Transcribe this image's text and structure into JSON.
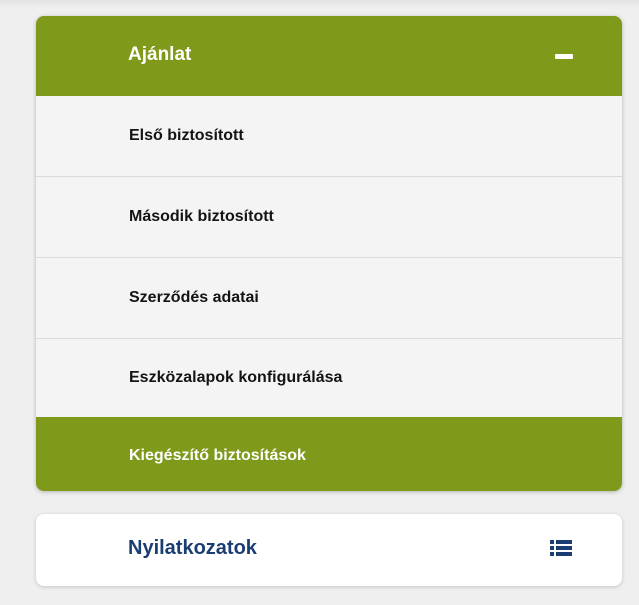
{
  "accordion": {
    "title": "Ajánlat",
    "collapse_icon": "minus-icon",
    "items": [
      {
        "label": "Első biztosított"
      },
      {
        "label": "Második biztosított"
      },
      {
        "label": "Szerződés adatai"
      },
      {
        "label": "Eszközalapok konfigurálása"
      },
      {
        "label": "Kiegészítő biztosítások"
      }
    ],
    "active_index": 4,
    "accent_color": "#7f9a1a"
  },
  "card": {
    "title": "Nyilatkozatok",
    "icon": "list-icon",
    "title_color": "#1b3e72"
  }
}
